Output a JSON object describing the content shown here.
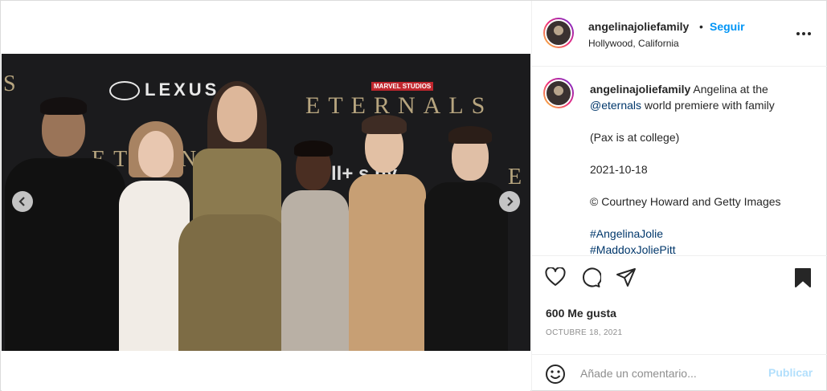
{
  "post": {
    "header": {
      "username": "angelinajoliefamily",
      "separator": "•",
      "follow_label": "Seguir",
      "location": "Hollywood, California",
      "more_icon": "more-horizontal-icon"
    },
    "media": {
      "backdrop": {
        "lexus": "LEXUS",
        "marvel": "MARVEL STUDIOS",
        "eternals": "ETERNALS",
        "eternals_partial": "ETERNALS",
        "eternals_edge_left": "S",
        "eternals_edge_right": "E",
        "disney": "ll+ s         ny"
      },
      "carousel_index": 2,
      "carousel_count": 5
    },
    "caption": {
      "username": "angelinajoliefamily",
      "text_before": " Angelina at the",
      "mention": "@eternals",
      "text_after": " world premiere with family",
      "line2": "(Pax is at college)",
      "line3": "2021-10-18",
      "line4": "© Courtney Howard and Getty Images",
      "tags": [
        "#AngelinaJolie",
        "#MaddoxJoliePitt"
      ]
    },
    "likes": "600 Me gusta",
    "date": "OCTUBRE 18, 2021",
    "comment_box": {
      "placeholder": "Añade un comentario...",
      "publish_label": "Publicar"
    },
    "colors": {
      "link_blue": "#0095f6",
      "publish_disabled": "#b2dffc",
      "mention": "#00376b"
    }
  }
}
